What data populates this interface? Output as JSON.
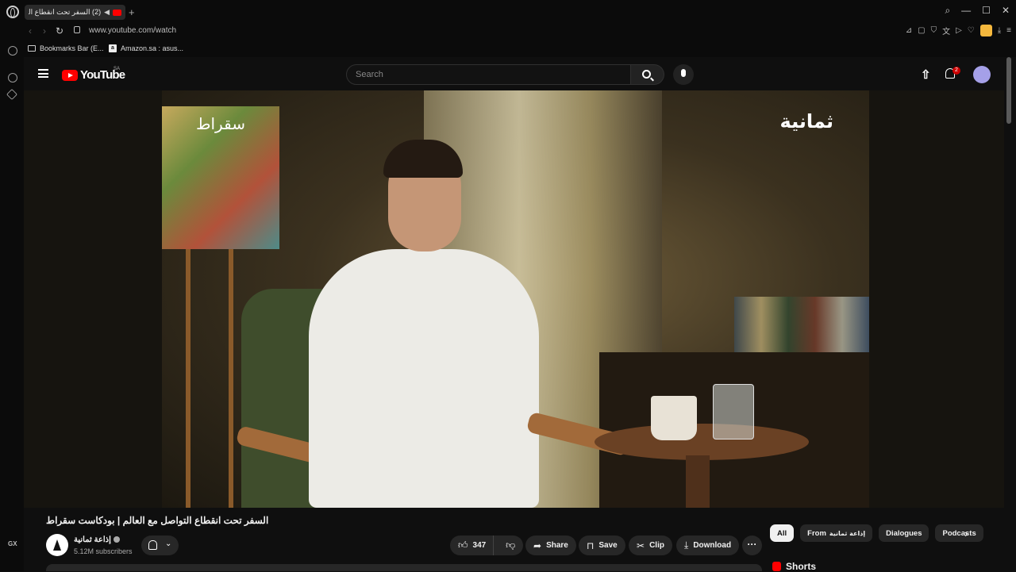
{
  "browser": {
    "tab_title": "(2) السفر تحت انقطاع التر",
    "url": "www.youtube.com/watch",
    "bookmarks": [
      "Bookmarks Bar (E...",
      "Amazon.sa : asus..."
    ],
    "side_label": "GX"
  },
  "header": {
    "logo_text": "YouTube",
    "country_code": "SA",
    "search_placeholder": "Search",
    "notification_count": "2"
  },
  "video": {
    "overlay_left": "سقراط",
    "overlay_right": "ثمانية",
    "title": "السفر تحت انقطاع التواصل مع العالم | بودكاست سقراط"
  },
  "channel": {
    "name": "إذاعة ثمانية",
    "subscribers": "5.12M subscribers"
  },
  "actions": {
    "like_count": "347",
    "share": "Share",
    "save": "Save",
    "clip": "Clip",
    "download": "Download"
  },
  "chips": [
    "All",
    "From",
    "إذاعة ثمانية",
    "Dialogues",
    "Podcasts"
  ],
  "sidebar": {
    "shorts_label": "Shorts"
  },
  "colors": {
    "accent_red": "#ff0000",
    "background": "#0f0f0f",
    "pill": "#272727"
  }
}
